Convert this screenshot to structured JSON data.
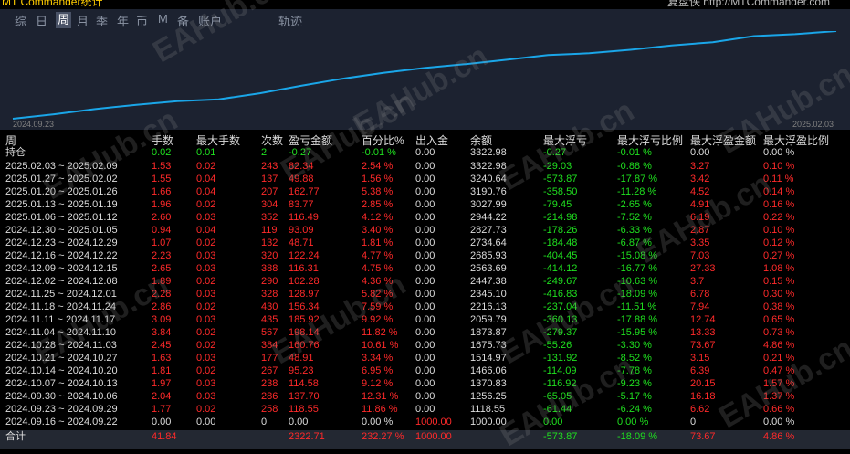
{
  "app": {
    "title": "MT Commander统计",
    "right_text": "复盘侠 http://MTCommander.com"
  },
  "tabs": [
    "综",
    "日",
    "周",
    "月",
    "季",
    "年",
    "币",
    "M",
    "备",
    "账户",
    "轨迹"
  ],
  "active_tab": "周",
  "chart": {
    "start_date": "2024.09.23",
    "end_date": "2025.02.03",
    "line_color": "#1aa6e8"
  },
  "chart_data": {
    "type": "line",
    "x": [
      "2024.09.23",
      "2024.09.30",
      "2024.10.07",
      "2024.10.14",
      "2024.10.21",
      "2024.10.28",
      "2024.11.04",
      "2024.11.11",
      "2024.11.18",
      "2024.11.25",
      "2024.12.02",
      "2024.12.09",
      "2024.12.16",
      "2024.12.23",
      "2024.12.30",
      "2025.01.06",
      "2025.01.13",
      "2025.01.20",
      "2025.01.27",
      "2025.02.03"
    ],
    "values": [
      1000.0,
      1118.55,
      1256.25,
      1370.83,
      1466.06,
      1514.97,
      1675.73,
      1873.87,
      2059.79,
      2216.13,
      2345.1,
      2447.38,
      2563.69,
      2685.93,
      2734.64,
      2827.73,
      2944.22,
      3027.99,
      3190.76,
      3240.64,
      3322.98
    ]
  },
  "table": {
    "headers": [
      "周",
      "手数",
      "最大手数",
      "次数",
      "盈亏金额",
      "百分比%",
      "出入金",
      "余额",
      "最大浮亏",
      "最大浮亏比例",
      "最大浮盈金额",
      "最大浮盈比例"
    ],
    "holding": [
      "持仓",
      "0.02",
      "0.01",
      "2",
      "-0.27",
      "-0.01 %",
      "0.00",
      "3322.98",
      "-0.27",
      "-0.01 %",
      "0.00",
      "0.00 %"
    ],
    "rows": [
      [
        "2025.02.03 ~ 2025.02.09",
        "1.53",
        "0.02",
        "243",
        "82.34",
        "2.54 %",
        "0.00",
        "3322.98",
        "-29.03",
        "-0.88 %",
        "3.27",
        "0.10 %"
      ],
      [
        "2025.01.27 ~ 2025.02.02",
        "1.55",
        "0.04",
        "137",
        "49.88",
        "1.56 %",
        "0.00",
        "3240.64",
        "-573.87",
        "-17.87 %",
        "3.42",
        "0.11 %"
      ],
      [
        "2025.01.20 ~ 2025.01.26",
        "1.66",
        "0.04",
        "207",
        "162.77",
        "5.38 %",
        "0.00",
        "3190.76",
        "-358.50",
        "-11.28 %",
        "4.52",
        "0.14 %"
      ],
      [
        "2025.01.13 ~ 2025.01.19",
        "1.96",
        "0.02",
        "304",
        "83.77",
        "2.85 %",
        "0.00",
        "3027.99",
        "-79.45",
        "-2.65 %",
        "4.91",
        "0.16 %"
      ],
      [
        "2025.01.06 ~ 2025.01.12",
        "2.60",
        "0.03",
        "352",
        "116.49",
        "4.12 %",
        "0.00",
        "2944.22",
        "-214.98",
        "-7.52 %",
        "6.19",
        "0.22 %"
      ],
      [
        "2024.12.30 ~ 2025.01.05",
        "0.94",
        "0.04",
        "119",
        "93.09",
        "3.40 %",
        "0.00",
        "2827.73",
        "-178.26",
        "-6.33 %",
        "2.87",
        "0.10 %"
      ],
      [
        "2024.12.23 ~ 2024.12.29",
        "1.07",
        "0.02",
        "132",
        "48.71",
        "1.81 %",
        "0.00",
        "2734.64",
        "-184.48",
        "-6.87 %",
        "3.35",
        "0.12 %"
      ],
      [
        "2024.12.16 ~ 2024.12.22",
        "2.23",
        "0.03",
        "320",
        "122.24",
        "4.77 %",
        "0.00",
        "2685.93",
        "-404.45",
        "-15.08 %",
        "7.03",
        "0.27 %"
      ],
      [
        "2024.12.09 ~ 2024.12.15",
        "2.65",
        "0.03",
        "388",
        "116.31",
        "4.75 %",
        "0.00",
        "2563.69",
        "-414.12",
        "-16.77 %",
        "27.33",
        "1.08 %"
      ],
      [
        "2024.12.02 ~ 2024.12.08",
        "1.89",
        "0.02",
        "290",
        "102.28",
        "4.36 %",
        "0.00",
        "2447.38",
        "-249.67",
        "-10.63 %",
        "3.7",
        "0.15 %"
      ],
      [
        "2024.11.25 ~ 2024.12.01",
        "2.28",
        "0.03",
        "328",
        "128.97",
        "5.82 %",
        "0.00",
        "2345.10",
        "-416.83",
        "-18.09 %",
        "6.78",
        "0.30 %"
      ],
      [
        "2024.11.18 ~ 2024.11.24",
        "2.86",
        "0.02",
        "430",
        "156.34",
        "7.59 %",
        "0.00",
        "2216.13",
        "-237.04",
        "-11.51 %",
        "7.94",
        "0.38 %"
      ],
      [
        "2024.11.11 ~ 2024.11.17",
        "3.09",
        "0.03",
        "435",
        "185.92",
        "9.92 %",
        "0.00",
        "2059.79",
        "-360.13",
        "-17.88 %",
        "12.74",
        "0.65 %"
      ],
      [
        "2024.11.04 ~ 2024.11.10",
        "3.84",
        "0.02",
        "567",
        "198.14",
        "11.82 %",
        "0.00",
        "1873.87",
        "-279.37",
        "-15.95 %",
        "13.33",
        "0.73 %"
      ],
      [
        "2024.10.28 ~ 2024.11.03",
        "2.45",
        "0.02",
        "384",
        "160.76",
        "10.61 %",
        "0.00",
        "1675.73",
        "-55.26",
        "-3.30 %",
        "73.67",
        "4.86 %"
      ],
      [
        "2024.10.21 ~ 2024.10.27",
        "1.63",
        "0.03",
        "177",
        "48.91",
        "3.34 %",
        "0.00",
        "1514.97",
        "-131.92",
        "-8.52 %",
        "3.15",
        "0.21 %"
      ],
      [
        "2024.10.14 ~ 2024.10.20",
        "1.81",
        "0.02",
        "267",
        "95.23",
        "6.95 %",
        "0.00",
        "1466.06",
        "-114.09",
        "-7.78 %",
        "6.39",
        "0.47 %"
      ],
      [
        "2024.10.07 ~ 2024.10.13",
        "1.97",
        "0.03",
        "238",
        "114.58",
        "9.12 %",
        "0.00",
        "1370.83",
        "-116.92",
        "-9.23 %",
        "20.15",
        "1.57 %"
      ],
      [
        "2024.09.30 ~ 2024.10.06",
        "2.04",
        "0.03",
        "286",
        "137.70",
        "12.31 %",
        "0.00",
        "1256.25",
        "-65.05",
        "-5.17 %",
        "16.18",
        "1.37 %"
      ],
      [
        "2024.09.23 ~ 2024.09.29",
        "1.77",
        "0.02",
        "258",
        "118.55",
        "11.86 %",
        "0.00",
        "1118.55",
        "-61.44",
        "-6.24 %",
        "6.62",
        "0.66 %"
      ],
      [
        "2024.09.16 ~ 2024.09.22",
        "0.00",
        "0.00",
        "0",
        "0.00",
        "0.00 %",
        "1000.00",
        "1000.00",
        "0.00",
        "0.00 %",
        "0",
        "0.00 %"
      ]
    ],
    "total": [
      "合计",
      "41.84",
      "",
      "",
      "2322.71",
      "232.27 %",
      "1000.00",
      "",
      "-573.87",
      "-18.09 %",
      "73.67",
      "4.86 %"
    ]
  },
  "watermark": "EAHub.cn",
  "colors": {
    "red": "#ff2a2a",
    "green": "#1fe01f",
    "white": "#dcdcdc",
    "background": "#000000",
    "panel": "#1c2230"
  }
}
